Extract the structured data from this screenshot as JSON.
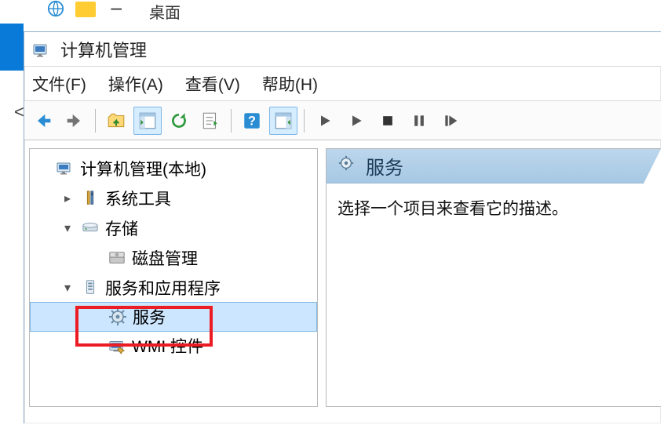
{
  "background": {
    "desktop_label": "桌面",
    "minus": "−",
    "chev": "<"
  },
  "window": {
    "title": "计算机管理"
  },
  "menu": {
    "file": "文件(F)",
    "action": "操作(A)",
    "view": "查看(V)",
    "help": "帮助(H)"
  },
  "tree": {
    "root": "计算机管理(本地)",
    "system_tools": "系统工具",
    "storage": "存储",
    "disk_mgmt": "磁盘管理",
    "services_apps": "服务和应用程序",
    "services": "服务",
    "wmi": "WMI 控件"
  },
  "detail": {
    "header": "服务",
    "hint": "选择一个项目来查看它的描述。"
  },
  "colors": {
    "accent_blue": "#7db7e8",
    "highlight_bg": "#cde6ff",
    "red": "#ec1c24"
  }
}
